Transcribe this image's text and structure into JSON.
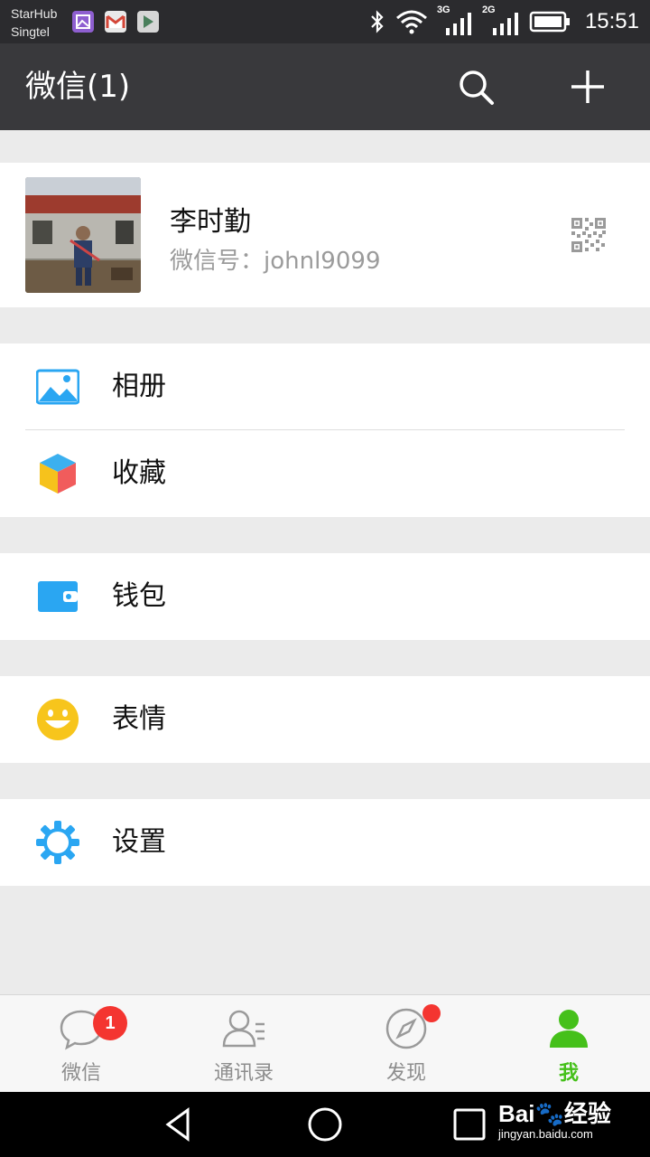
{
  "status_bar": {
    "carrier1": "StarHub",
    "carrier2": "Singtel",
    "net1": "3G",
    "net2": "2G",
    "time": "15:51"
  },
  "header": {
    "title": "微信(1)"
  },
  "profile": {
    "name": "李时勤",
    "wechat_id": "微信号：johnl9099"
  },
  "menu": {
    "album": "相册",
    "favorites": "收藏",
    "wallet": "钱包",
    "stickers": "表情",
    "settings": "设置"
  },
  "tabs": [
    {
      "label": "微信",
      "badge": "1"
    },
    {
      "label": "通讯录"
    },
    {
      "label": "发现"
    },
    {
      "label": "我"
    }
  ],
  "watermark": {
    "brand": "Bai",
    "brand2": "经验",
    "url": "jingyan.baidu.com"
  },
  "colors": {
    "accent_green": "#45c01a",
    "badge_red": "#f43530",
    "header": "#39393c"
  }
}
